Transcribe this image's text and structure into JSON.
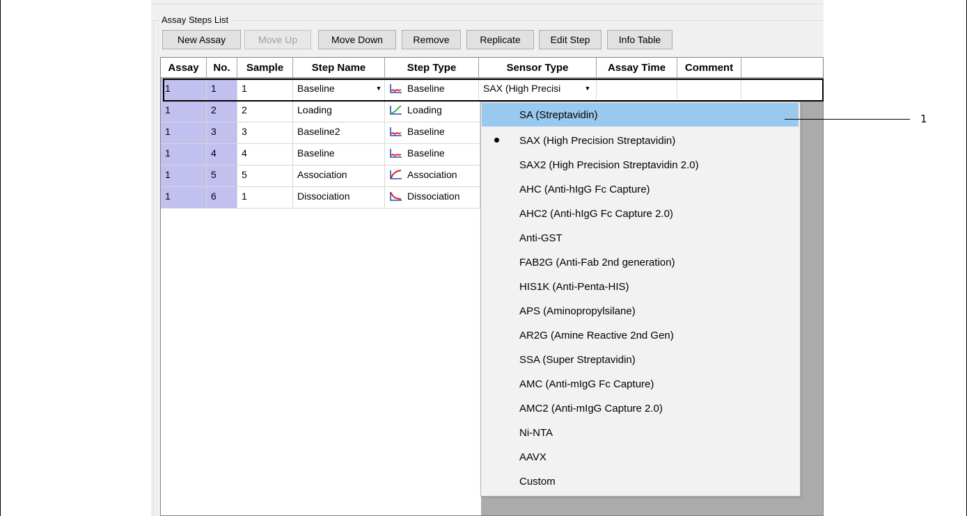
{
  "group_title": "Assay Steps List",
  "toolbar": {
    "new_assay": "New Assay",
    "move_up": "Move Up",
    "move_down": "Move Down",
    "remove": "Remove",
    "replicate": "Replicate",
    "edit_step": "Edit Step",
    "info_table": "Info Table"
  },
  "columns": [
    "Assay",
    "No.",
    "Sample",
    "Step Name",
    "Step Type",
    "Sensor Type",
    "Assay Time",
    "Comment"
  ],
  "rows": [
    {
      "assay": "1",
      "no": "1",
      "sample": "1",
      "step_name": "Baseline",
      "step_type": "Baseline",
      "sensor_type": "SAX (High Precisi",
      "icon": "baseline-icon"
    },
    {
      "assay": "1",
      "no": "2",
      "sample": "2",
      "step_name": "Loading",
      "step_type": "Loading",
      "icon": "loading-icon"
    },
    {
      "assay": "1",
      "no": "3",
      "sample": "3",
      "step_name": "Baseline2",
      "step_type": "Baseline",
      "icon": "baseline-icon"
    },
    {
      "assay": "1",
      "no": "4",
      "sample": "4",
      "step_name": "Baseline",
      "step_type": "Baseline",
      "icon": "baseline-icon"
    },
    {
      "assay": "1",
      "no": "5",
      "sample": "5",
      "step_name": "Association",
      "step_type": "Association",
      "icon": "association-icon"
    },
    {
      "assay": "1",
      "no": "6",
      "sample": "1",
      "step_name": "Dissociation",
      "step_type": "Dissociation",
      "icon": "dissociation-icon"
    }
  ],
  "dropdown": {
    "highlighted_index": 0,
    "selected_index": 1,
    "options": [
      "SA (Streptavidin)",
      "SAX (High Precision Streptavidin)",
      "SAX2 (High Precision Streptavidin 2.0)",
      "AHC (Anti-hIgG Fc Capture)",
      "AHC2 (Anti-hIgG Fc Capture 2.0)",
      "Anti-GST",
      "FAB2G (Anti-Fab 2nd generation)",
      "HIS1K (Anti-Penta-HIS)",
      "APS (Aminopropylsilane)",
      "AR2G (Amine Reactive 2nd Gen)",
      "SSA (Super Streptavidin)",
      "AMC (Anti-mIgG Fc Capture)",
      "AMC2 (Anti-mIgG Capture 2.0)",
      "Ni-NTA",
      "AAVX",
      "Custom"
    ]
  },
  "callout": "1",
  "colors": {
    "row_highlight": "#c2c0ee",
    "dropdown_highlight": "#99c9ef",
    "grid_background": "#ababab"
  }
}
